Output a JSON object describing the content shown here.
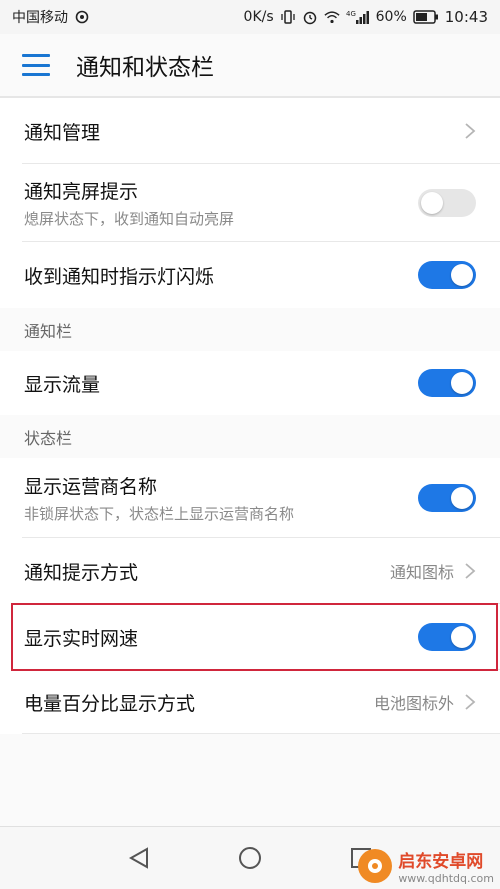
{
  "status": {
    "carrier": "中国移动",
    "net_speed": "0K/s",
    "network": "4G",
    "battery": "60%",
    "time": "10:43"
  },
  "appbar": {
    "title": "通知和状态栏"
  },
  "rows": {
    "notif_manage": {
      "title": "通知管理"
    },
    "wake_screen": {
      "title": "通知亮屏提示",
      "sub": "熄屏状态下，收到通知自动亮屏",
      "on": false
    },
    "led_blink": {
      "title": "收到通知时指示灯闪烁",
      "on": true
    },
    "show_traffic": {
      "title": "显示流量",
      "on": true
    },
    "carrier_name": {
      "title": "显示运营商名称",
      "sub": "非锁屏状态下，状态栏上显示运营商名称",
      "on": true
    },
    "notif_method": {
      "title": "通知提示方式",
      "value": "通知图标"
    },
    "realtime_speed": {
      "title": "显示实时网速",
      "on": true
    },
    "battery_pct": {
      "title": "电量百分比显示方式",
      "value": "电池图标外"
    }
  },
  "sections": {
    "notif_bar": "通知栏",
    "status_bar": "状态栏"
  },
  "watermark": {
    "title": "启东安卓网",
    "url": "www.qdhtdq.com"
  },
  "colors": {
    "accent": "#1e78e6",
    "highlight": "#d0263c"
  }
}
